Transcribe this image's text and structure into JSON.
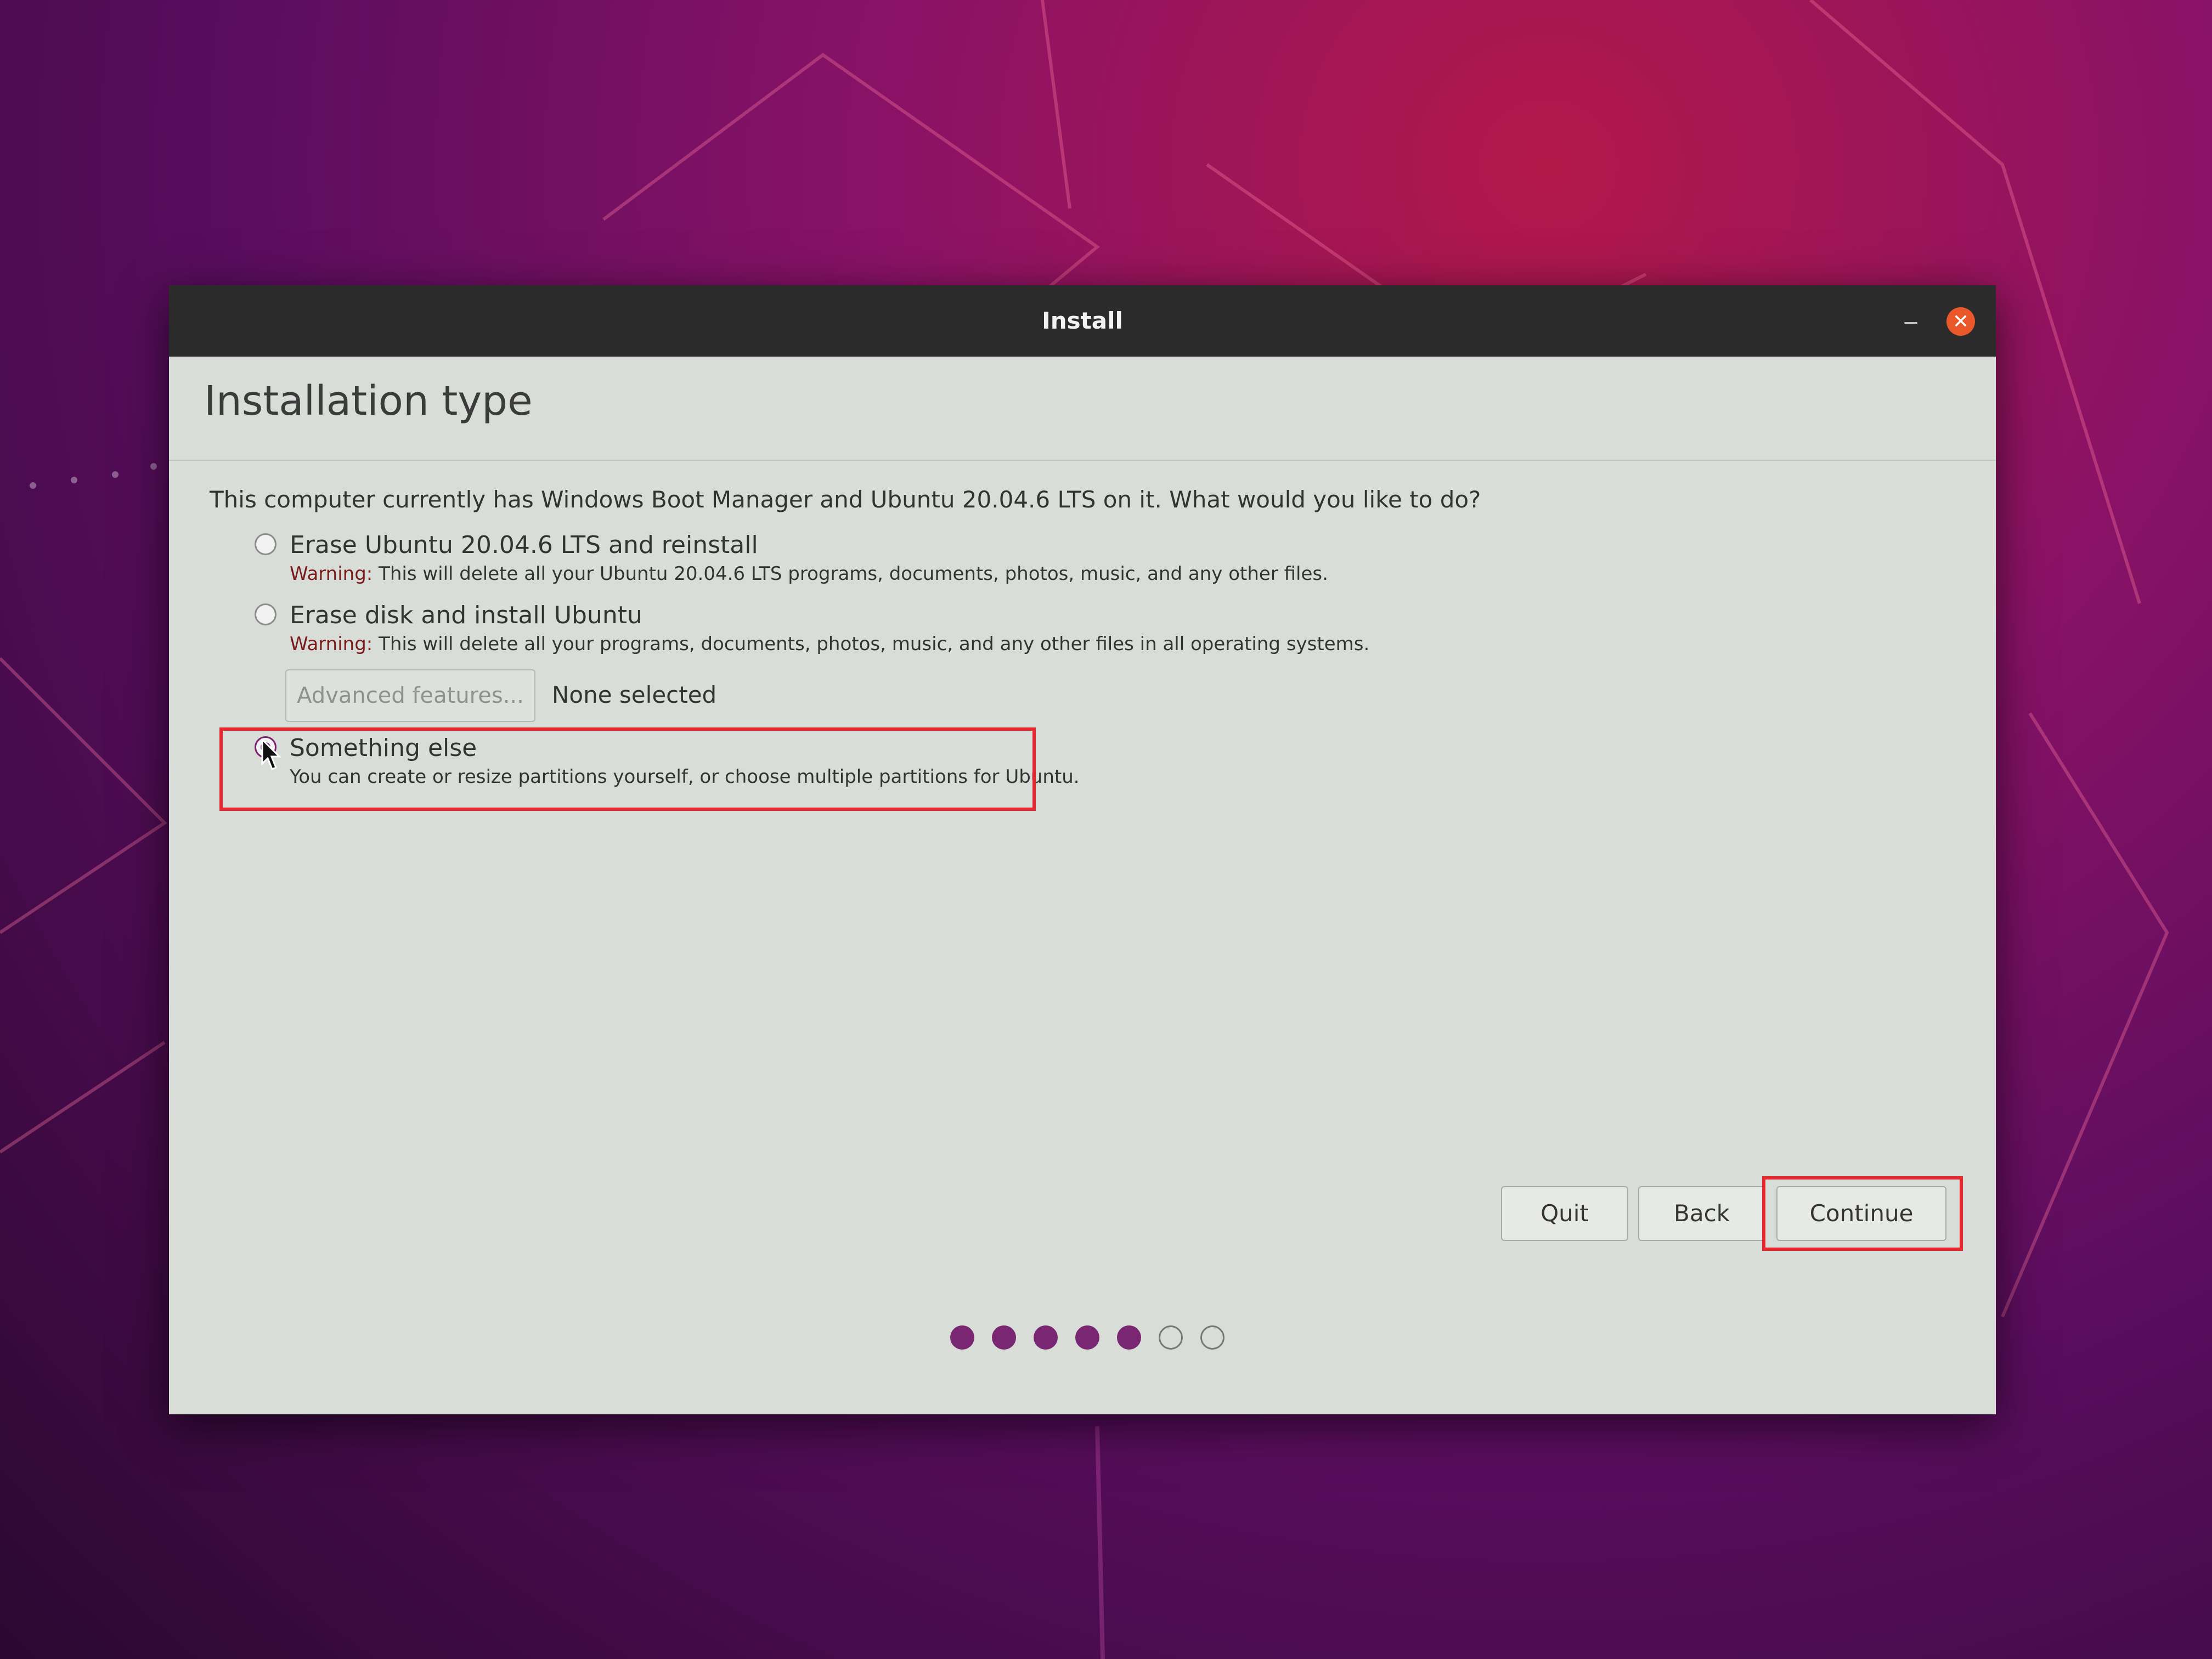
{
  "window": {
    "title": "Install",
    "minimize_glyph": "–",
    "close_glyph": "✕"
  },
  "page": {
    "title": "Installation type",
    "question": "This computer currently has Windows Boot Manager and Ubuntu 20.04.6 LTS on it. What would you like to do?"
  },
  "options": [
    {
      "label": "Erase Ubuntu 20.04.6 LTS and reinstall",
      "warning_prefix": "Warning:",
      "description": " This will delete all your Ubuntu 20.04.6 LTS programs, documents, photos, music, and any other files.",
      "checked": false
    },
    {
      "label": "Erase disk and install Ubuntu",
      "warning_prefix": "Warning:",
      "description": " This will delete all your programs, documents, photos, music, and any other files in all operating systems.",
      "checked": false
    },
    {
      "label": "Something else",
      "description": "You can create or resize partitions yourself, or choose multiple partitions for Ubuntu.",
      "checked": true
    }
  ],
  "advanced": {
    "button_label": "Advanced features...",
    "status": "None selected"
  },
  "buttons": {
    "quit": "Quit",
    "back": "Back",
    "continue": "Continue"
  },
  "progress": {
    "total_steps": 7,
    "completed_steps": 5
  },
  "colors": {
    "accent": "#77216f",
    "highlight": "#e8262d",
    "close_button": "#e9572a"
  }
}
